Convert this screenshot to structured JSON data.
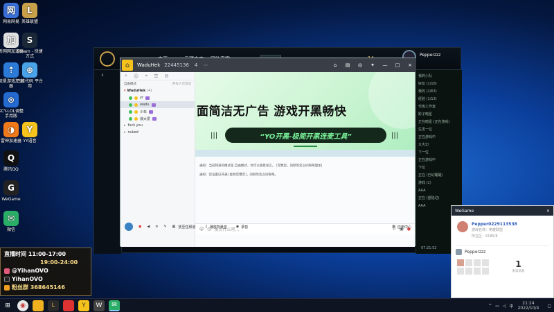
{
  "desktop_icons": [
    {
      "name": "rent-acc-icon",
      "label": "网易网易",
      "color": "#3a6fd8"
    },
    {
      "name": "lol-icon",
      "label": "英雄联盟",
      "color": "#c8a04a"
    },
    {
      "name": "tencent-acc-icon",
      "label": "新网网加速器",
      "color": "#e0e0e0"
    },
    {
      "name": "steam-icon",
      "label": "Steam - 快捷方式",
      "color": "#1b2838"
    },
    {
      "name": "star-acc-icon",
      "label": "流星游戏加速器",
      "color": "#2c7bd9"
    },
    {
      "name": "wellbia-icon",
      "label": "三维代码 平台用",
      "color": "#4aa3e8"
    },
    {
      "name": "acc-plain-icon",
      "label": "KCY-LOL调整 手用版",
      "color": "#246ad1"
    },
    {
      "name": "leiyin-icon",
      "label": "雷神加速器",
      "color": "#f07a1a"
    },
    {
      "name": "yy-icon",
      "label": "YY语音",
      "color": "#f6c21c"
    },
    {
      "name": "qq-icon",
      "label": "腾讯QQ",
      "color": "#111"
    },
    {
      "name": "wegame-icon",
      "label": "WeGame",
      "color": "#222"
    },
    {
      "name": "wechat-icon",
      "label": "微信",
      "color": "#2aae67"
    }
  ],
  "lol": {
    "nav": [
      "主页",
      "云顶之弈",
      "团队竞赛"
    ],
    "currency": "14",
    "user": "Pepperzzz",
    "friends": [
      "我的小队",
      "好友 (1/18)",
      "我的 (2/63)",
      "经验 (1/13)",
      "代练工作室",
      "影子暗星",
      "正在暗星 (正在游戏)",
      "生发一位",
      "正在游戏中",
      "大大幻",
      "下一位",
      "正在游戏中",
      "下位",
      "正在 (已幻睡醒)",
      "游戏 (2)",
      "AAA",
      "正在 (登陆过)",
      "AAA"
    ],
    "time": "07:21:52"
  },
  "yy": {
    "channel_name": "WaduHek",
    "channel_id": "22445136",
    "online": "4",
    "mode_label": "自由模式",
    "mode_sub": "所有人可说话",
    "room": "WaduHek",
    "room_count": "(4)",
    "members": [
      "yr",
      "wadu",
      "少年",
      "浪大爱"
    ],
    "sub_rooms": [
      "fuck you",
      "nuked"
    ],
    "banner_title": "面简洁无广告 游戏开黑畅快",
    "banner_slogan": "“YO开黑-极简开黑连麦工具”",
    "notice_1": "通知：当前频道的模式是 自由模式，你可以随意发言。 [常数思，同频等您占同每每理加]",
    "notice_2": "通知：您设置已开通 [金频常曝音]，同频等您占同每每。",
    "input_placeholder": "发点什么吧...",
    "bottom_left": "放至任频道",
    "bottom_music": "播放背景音",
    "bottom_record": "录音",
    "bottom_right": "应用中心"
  },
  "wegame": {
    "title": "WeGame",
    "user_id": "Pepper0229113538",
    "role_label": "游戏名称：",
    "role_val": "英雄联盟",
    "status_label": "所在区：",
    "status_val": "6185/8",
    "friend": "Pepperzzz",
    "count": "1",
    "count_label": "未读消息"
  },
  "stream": {
    "line1": "直播时间 11:00-17:00",
    "line2": "19:00-24:00",
    "line3": "@YihanOVO",
    "line4": "YihanOVO",
    "line5": "粉丝群 368645146"
  },
  "taskbar": {
    "time": "21:24",
    "date": "2022/10/4",
    "ime": "中"
  }
}
